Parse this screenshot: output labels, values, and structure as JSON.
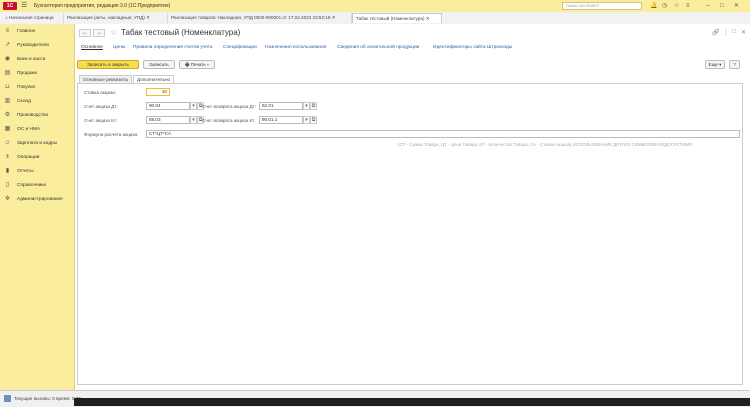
{
  "app_title": "Бухгалтерия предприятия, редакция 3.0  (1С:Предприятие)",
  "search_placeholder": "Поиск Ctrl+Shift+F",
  "tabs": [
    {
      "label": "Начальная страница"
    },
    {
      "label": "Реализация (акты, накладные, УПД)"
    },
    {
      "label": "Реализация товаров: Накладная, УПД 0000-000001 от 17.04.2022 23:52:16"
    },
    {
      "label": "Табак тестовый (Номенклатура)"
    }
  ],
  "sidebar": {
    "items": [
      {
        "label": "Главное",
        "icon": "menu-icon"
      },
      {
        "label": "Руководителю",
        "icon": "chart-icon"
      },
      {
        "label": "Банк и касса",
        "icon": "bank-icon"
      },
      {
        "label": "Продажи",
        "icon": "cart-icon"
      },
      {
        "label": "Покупки",
        "icon": "basket-icon"
      },
      {
        "label": "Склад",
        "icon": "warehouse-icon"
      },
      {
        "label": "Производство",
        "icon": "factory-icon"
      },
      {
        "label": "ОС и НМА",
        "icon": "building-icon"
      },
      {
        "label": "Зарплата и кадры",
        "icon": "people-icon"
      },
      {
        "label": "Операции",
        "icon": "dt-kt-icon"
      },
      {
        "label": "Отчеты",
        "icon": "report-icon"
      },
      {
        "label": "Справочники",
        "icon": "book-icon"
      },
      {
        "label": "Администрирование",
        "icon": "gear-icon"
      }
    ]
  },
  "document": {
    "title": "Табак тестовый (Номенклатура)"
  },
  "links": [
    {
      "label": "Основное"
    },
    {
      "label": "Цены"
    },
    {
      "label": "Правила определения счетов учета"
    },
    {
      "label": "Спецификации"
    },
    {
      "label": "Назначения использования"
    },
    {
      "label": "Сведения об алкогольной продукции"
    },
    {
      "label": "Идентификаторы сайта"
    },
    {
      "label": "Штрихкоды"
    }
  ],
  "toolbar": {
    "save_close": "Записать и закрыть",
    "save": "Записать",
    "print": "Печать",
    "more": "Еще",
    "help": "?"
  },
  "subtabs": [
    {
      "label": "Основные реквизиты"
    },
    {
      "label": "Дополнительно"
    }
  ],
  "form": {
    "excise_rate_label": "Ставка акциза:",
    "excise_rate_value": "10",
    "account_dt_label": "Счет акциза Дт:",
    "account_dt_value": "90.04",
    "account_kt_label": "Счет акциза Кт:",
    "account_kt_value": "68.03",
    "return_dt_label": "Счет возврата акциза Дт:",
    "return_dt_value": "62.01",
    "return_kt_label": "Счет возврата акциза Кт:",
    "return_kt_value": "90.01.1",
    "formula_label": "Формула расчета акциза:",
    "formula_value": "СТ*ЦТ*СА",
    "hint": "(СТ - Сумма Товара, ЦТ - Цена Товара, КТ - Количество Товара, СА - Ставка Акциза) ИСПОЛЬЗОВАНИЕ ДРУГИХ СИМВОЛОВ НЕДОПУСТИМО"
  },
  "statusbar": {
    "text": "Текущие вызовы: 0   время: 0.00"
  }
}
